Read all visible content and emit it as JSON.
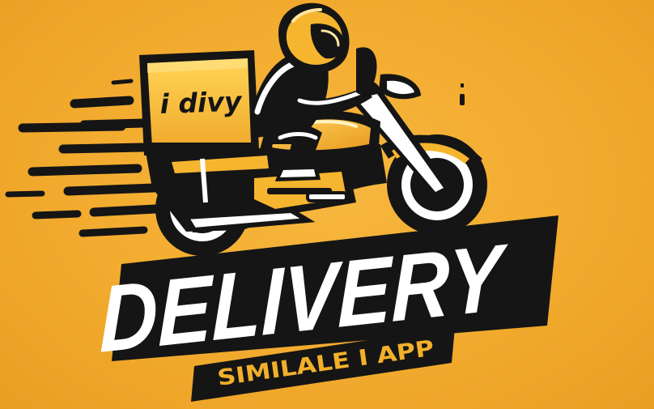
{
  "logo": {
    "box_label": "i divy",
    "headline": "DELIVERY",
    "subtitle": "SIMILALE I APP"
  },
  "colors": {
    "background": "#f2ab2e",
    "accent": "#f5b52e",
    "dark": "#151515",
    "light": "#ffffff",
    "subtitle": "#f2b02a"
  },
  "icons": {
    "rider": "delivery-rider-icon",
    "motorcycle": "motorcycle-icon",
    "box": "delivery-box-icon"
  }
}
